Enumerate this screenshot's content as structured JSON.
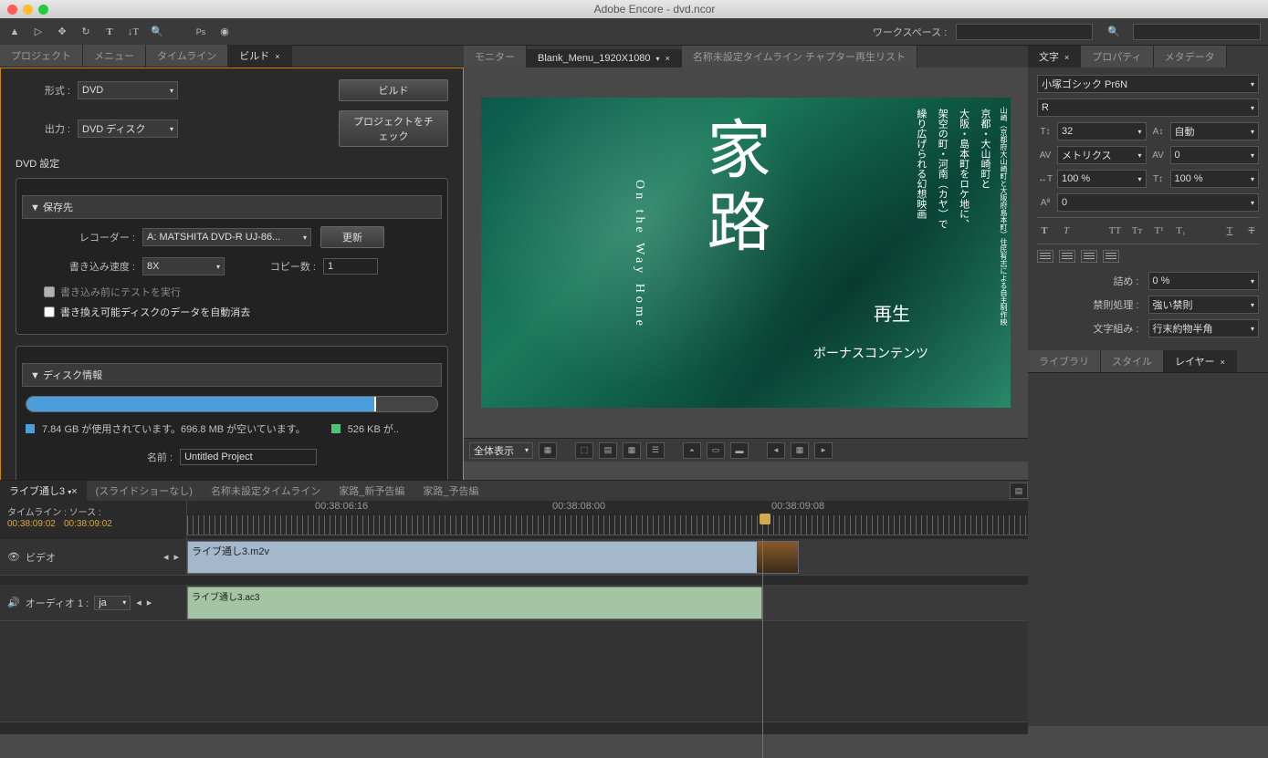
{
  "title": "Adobe Encore - dvd.ncor",
  "workspace_label": "ワークスペース :",
  "top_tabs": {
    "project": "プロジェクト",
    "menu": "メニュー",
    "timeline": "タイムライン",
    "build": "ビルド"
  },
  "monitor_tabs": {
    "monitor": "モニター",
    "menu_doc": "Blank_Menu_1920X1080",
    "playlist": "名称未設定タイムライン チャプター再生リスト"
  },
  "right_tabs1": {
    "char": "文字",
    "prop": "プロパティ",
    "meta": "メタデータ"
  },
  "right_tabs2": {
    "lib": "ライブラリ",
    "style": "スタイル",
    "layer": "レイヤー"
  },
  "build": {
    "format_label": "形式 :",
    "format_value": "DVD",
    "build_btn": "ビルド",
    "output_label": "出力 :",
    "output_value": "DVD ディスク",
    "check_btn": "プロジェクトをチェック",
    "settings_title": "DVD 設定",
    "dest_title": "▼ 保存先",
    "recorder_label": "レコーダー :",
    "recorder_value": "A: MATSHITA DVD-R   UJ-86...",
    "refresh_btn": "更新",
    "speed_label": "書き込み速度 :",
    "speed_value": "8X",
    "copies_label": "コピー数 :",
    "copies_value": "1",
    "test_chk": "書き込み前にテストを実行",
    "erase_chk": "書き換え可能ディスクのデータを自動消去",
    "disk_title": "▼ ディスク情報",
    "disk_used": "7.84 GB が使用されています。696.8 MB が空いています。",
    "disk_free": "526 KB が..",
    "name_label": "名前 :",
    "name_value": "Untitled Project"
  },
  "menu": {
    "title": "家路",
    "subtitle": "On the Way Home",
    "side1": "京都・大山崎町と",
    "side2": "大阪・島本町をロケ地に、",
    "side3": "架空の町・河南（カヤ）で",
    "side4": "繰り広げられる幻想映画",
    "credit": "山崎（京都府大山崎町と大阪府島本町）住民有志による自主制作映",
    "play": "再生",
    "bonus": "ボーナスコンテンツ"
  },
  "viewer": {
    "fit": "全体表示"
  },
  "tl_tabs": {
    "t0": "ライブ通し3",
    "t1": "(スライドショーなし)",
    "t2": "名称未設定タイムライン",
    "t3": "家路_新予告編",
    "t4": "家路_予告編"
  },
  "tl": {
    "src_label": "タイムライン :  ソース :",
    "tc1": "00:38:09:02",
    "tc2": "00:38:09:02",
    "ruler1": "00:38:06:16",
    "ruler2": "00:38:08:00",
    "ruler3": "00:38:09:08",
    "video_label": "ビデオ",
    "audio_label": "オーディオ 1 :",
    "audio_lang": "ja",
    "clip_v": "ライブ通し3.m2v",
    "clip_a": "ライブ通し3.ac3"
  },
  "char": {
    "font": "小塚ゴシック Pr6N",
    "style": "R",
    "size": "32",
    "leading": "自動",
    "kerning": "メトリクス",
    "tracking": "0",
    "hscale": "100 %",
    "vscale": "100 %",
    "baseline": "0",
    "tsume_label": "詰め :",
    "tsume": "0 %",
    "kinsoku_label": "禁則処理 :",
    "kinsoku": "強い禁則",
    "mojikumi_label": "文字組み :",
    "mojikumi": "行末約物半角"
  }
}
